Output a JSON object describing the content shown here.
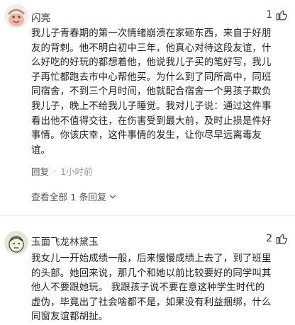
{
  "comments": [
    {
      "user": "闪亮",
      "likes": "1",
      "body_lines": [
        "我儿子青春期的第一次情绪崩溃在家砸东西，来自于好朋",
        "友的背刺。他不明白初中三年，他真心对待这段友谊，什",
        "么好吃的好玩的都想着他，他说我儿子买的笔好写，我儿",
        "子再忙都跑去市中心帮他买。为什么到了同所高中，同班",
        "同宿舍，不到三个月时间，他就配合宿舍一个男孩子欺负",
        "我儿子，晚上不给我儿子睡觉。我对儿子说：通过这件事",
        "看出他不值得交往，在伤害受到最大前，及时止损是件好",
        "事情。你该庆幸，这件事情的发生，让你尽早远离毒友",
        "谊。"
      ],
      "reply_label": "回复",
      "time": "1小时前",
      "view_replies": "查看全部 1 条回复"
    },
    {
      "user": "玉面飞龙林黛玉",
      "likes": "2",
      "body_lines": [
        "我女儿一开始成绩一般，后来慢慢成绩上去了，到了班里",
        "的头部。她回来说，那几个和她以前比较要好的同学叫其",
        "他人不要跟她玩。 我跟孩子说不要在意这种学生时代的",
        "虚伪，毕竟出了社会啥都不是，如果没有利益捆绑，什么",
        "同窗友谊都胡扯。"
      ]
    }
  ],
  "icons": {
    "like": "thumbs-up-icon",
    "chevron": "chevron-down-icon"
  }
}
